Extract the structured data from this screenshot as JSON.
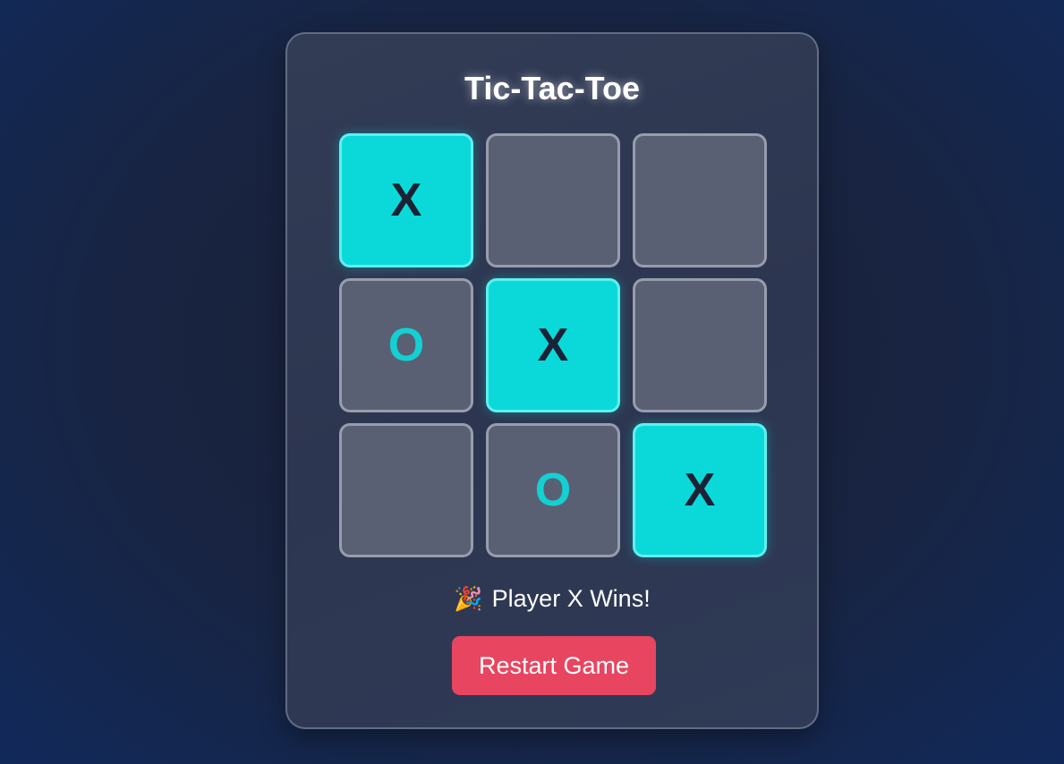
{
  "title": "Tic-Tac-Toe",
  "board": {
    "cells": [
      {
        "mark": "X",
        "winning": true
      },
      {
        "mark": "",
        "winning": false
      },
      {
        "mark": "",
        "winning": false
      },
      {
        "mark": "O",
        "winning": false
      },
      {
        "mark": "X",
        "winning": true
      },
      {
        "mark": "",
        "winning": false
      },
      {
        "mark": "",
        "winning": false
      },
      {
        "mark": "O",
        "winning": false
      },
      {
        "mark": "X",
        "winning": true
      }
    ]
  },
  "status": {
    "icon": "party-popper-icon",
    "emoji": "🎉",
    "text": "Player X Wins!"
  },
  "restart_button": {
    "label": "Restart Game"
  },
  "colors": {
    "accent": "#0bd9d9",
    "button": "#e84560",
    "mark_o": "#13d0d3",
    "mark_x": "#1b2236"
  }
}
